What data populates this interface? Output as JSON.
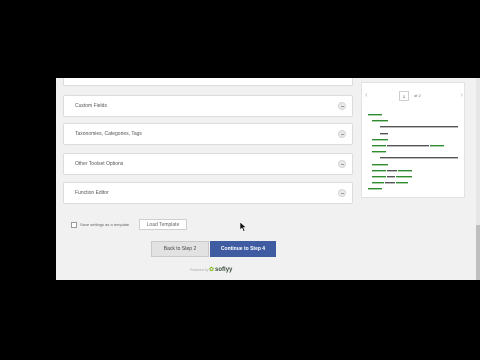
{
  "accordion": {
    "panels": [
      {
        "title": "Custom Fields"
      },
      {
        "title": "Taxonomies, Categories, Tags"
      },
      {
        "title": "Other Toolset Options"
      },
      {
        "title": "Function Editor"
      }
    ]
  },
  "template": {
    "checkbox_label": "Save settings as a template",
    "button_label": "Load Template"
  },
  "steps": {
    "back_label": "Back to Step 2",
    "next_label": "Continue to Step 4"
  },
  "powered_by": {
    "label": "Powered by",
    "brand": "soflyy"
  },
  "preview": {
    "page_number": "1",
    "page_of": "of 2"
  },
  "colors": {
    "primary_button": "#3f5ca3",
    "xml_tag": "#2e8b2e",
    "xml_text": "#333333",
    "brand_mark": "#8cbf2c"
  },
  "icons": {
    "collapse": "minus-circle-icon",
    "prev": "chevron-left-icon",
    "next": "chevron-right-icon",
    "pointer": "mouse-cursor-icon"
  }
}
